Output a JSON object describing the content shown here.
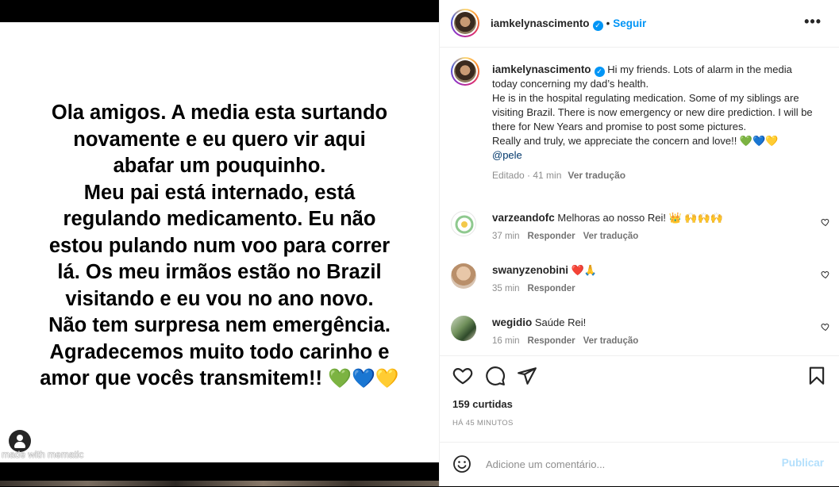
{
  "story": {
    "lines": [
      "Ola amigos. A media esta surtando",
      "novamente e eu quero vir aqui",
      "abafar um pouquinho.",
      "Meu pai está internado, está",
      "regulando medicamento. Eu não",
      "estou pulando num voo para correr",
      "lá. Os meu irmãos estão no Brazil",
      "visitando e eu vou no ano novo.",
      "Não tem surpresa nem emergência.",
      "Agradecemos muito todo carinho e",
      "amor que vocês transmitem!!"
    ],
    "hearts": "💚💙💛",
    "watermark": "made with mematic"
  },
  "header": {
    "username": "iamkelynascimento",
    "separator": "•",
    "follow_label": "Seguir",
    "more_label": "•••"
  },
  "caption": {
    "username": "iamkelynascimento",
    "paragraphs": [
      "Hi my friends. Lots of alarm in the media today concerning my dad’s health.",
      "He is in the hospital regulating medication. Some of my siblings are visiting Brazil. There is now emergency or new dire prediction. I will be there for New Years and promise to post some pictures.",
      "Really and truly, we appreciate the concern and love!! 💚💙💛"
    ],
    "mention": "@pele",
    "edited": "Editado · 41 min",
    "translate": "Ver tradução"
  },
  "comments": [
    {
      "username": "varzeandofc",
      "text": "Melhoras ao nosso Rei! 👑 🙌🙌🙌",
      "time": "37 min",
      "reply": "Responder",
      "translate": "Ver tradução"
    },
    {
      "username": "swanyzenobini",
      "text": "❤️🙏",
      "time": "35 min",
      "reply": "Responder",
      "translate": ""
    },
    {
      "username": "wegidio",
      "text": "Saúde Rei!",
      "time": "16 min",
      "reply": "Responder",
      "translate": "Ver tradução"
    }
  ],
  "actions": {
    "likes": "159 curtidas",
    "timestamp": "HÁ 45 MINUTOS"
  },
  "add_comment": {
    "placeholder": "Adicione um comentário...",
    "publish": "Publicar"
  },
  "colors": {
    "accent": "#0095f6",
    "publish_disabled": "#b2dffc",
    "like_red": "#ed4956"
  }
}
